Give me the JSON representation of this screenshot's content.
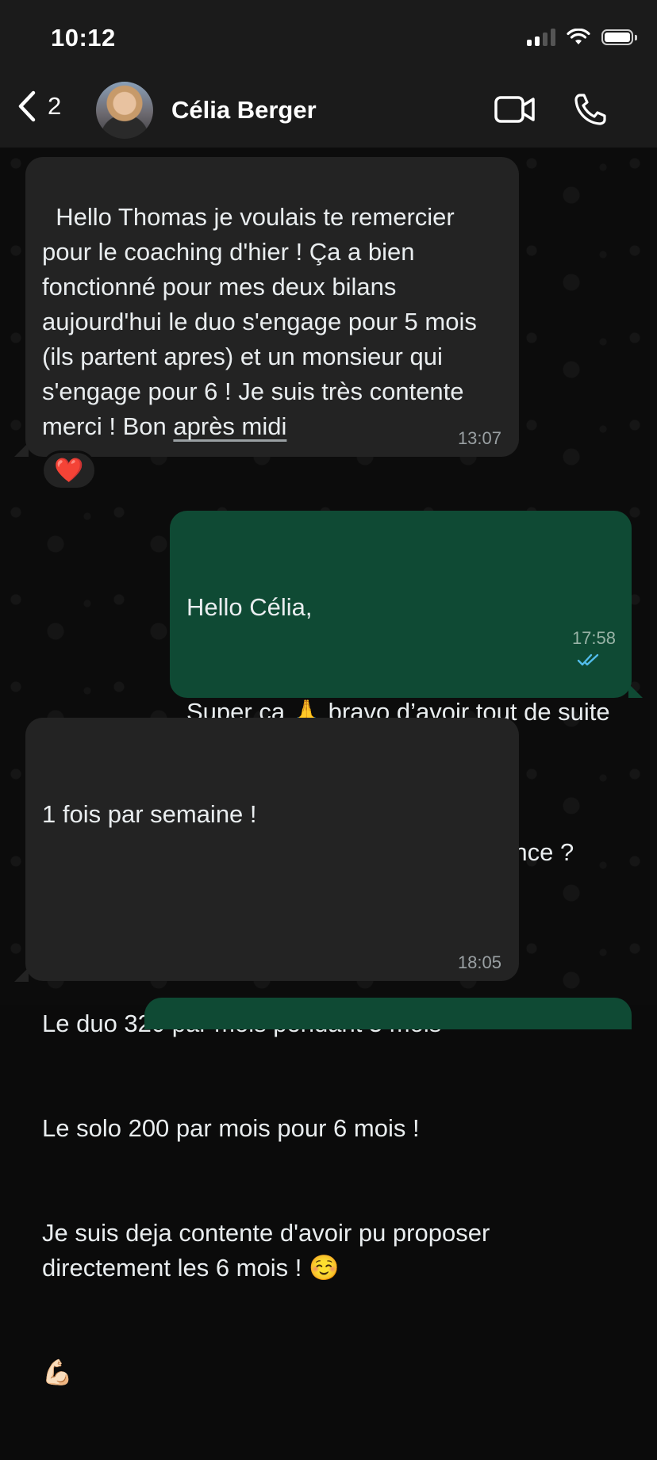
{
  "status_bar": {
    "time": "10:12"
  },
  "header": {
    "back_count": "2",
    "contact_name": "Célia Berger"
  },
  "icons": {
    "back": "chevron-left-icon",
    "video": "video-camera-icon",
    "call": "phone-icon",
    "read_receipt": "double-check-icon"
  },
  "colors": {
    "incoming_bubble": "#232323",
    "outgoing_bubble": "#0f4a34",
    "read_ticks": "#53bdeb",
    "header": "#1b1b1b"
  },
  "messages": [
    {
      "direction": "incoming",
      "text_main": "Hello Thomas je voulais te remercier pour le coaching d'hier ! Ça a bien fonctionné pour mes deux bilans aujourd'hui le duo s'engage pour 5 mois (ils partent apres) et un monsieur qui s'engage pour 6 ! Je suis très contente merci ! Bon ",
      "text_link": "après midi",
      "time": "13:07",
      "reaction": "❤️"
    },
    {
      "direction": "outgoing",
      "line1": "Hello Célia,",
      "line2_a": "Super ça ",
      "line2_emoji": "🙏",
      "line2_b": " bravo d’avoir tout de suite mis ça en application !",
      "line3": "Tu vas les voir à quelle fréquence ?",
      "time": "17:58",
      "status": "read"
    },
    {
      "direction": "incoming",
      "line1": "1 fois par semaine !",
      "line2": "Le duo 320 par mois pendant 5 mois",
      "line3": "Le solo 200 par mois pour 6 mois !",
      "line4": "Je suis deja contente d'avoir pu proposer directement les 6 mois ! ☺️",
      "line5": "💪🏻",
      "time": "18:05"
    }
  ]
}
